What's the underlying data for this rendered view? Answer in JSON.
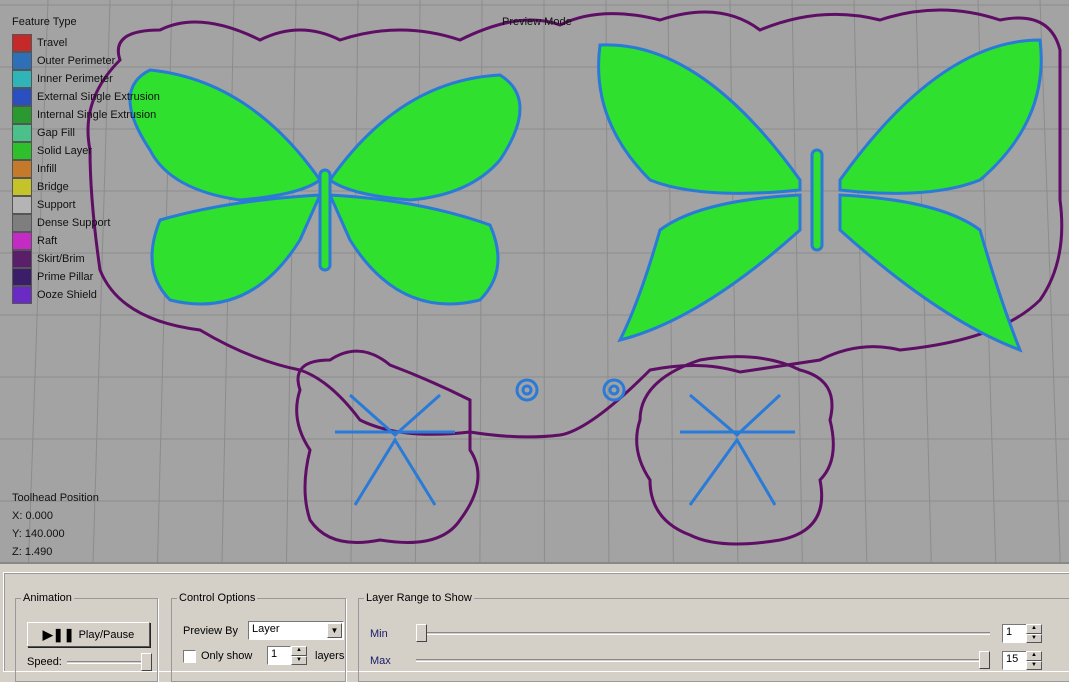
{
  "viewport": {
    "legend_title": "Feature Type",
    "legend": [
      {
        "label": "Travel",
        "color": "#c42a2a"
      },
      {
        "label": "Outer Perimeter",
        "color": "#2f6fb8"
      },
      {
        "label": "Inner Perimeter",
        "color": "#2fb5b8"
      },
      {
        "label": "External Single Extrusion",
        "color": "#2a4fc0"
      },
      {
        "label": "Internal Single Extrusion",
        "color": "#2a9a30"
      },
      {
        "label": "Gap Fill",
        "color": "#4cc08a"
      },
      {
        "label": "Solid Layer",
        "color": "#2ec02a"
      },
      {
        "label": "Infill",
        "color": "#c47a2a"
      },
      {
        "label": "Bridge",
        "color": "#c4c42a"
      },
      {
        "label": "Support",
        "color": "#b4b4b4"
      },
      {
        "label": "Dense Support",
        "color": "#7e7e7e"
      },
      {
        "label": "Raft",
        "color": "#c42ac4"
      },
      {
        "label": "Skirt/Brim",
        "color": "#5a1e6a"
      },
      {
        "label": "Prime Pillar",
        "color": "#3a1e6a"
      },
      {
        "label": "Ooze Shield",
        "color": "#6a2ac4"
      }
    ],
    "mode": "Preview Mode",
    "toolhead": {
      "title": "Toolhead Position",
      "x": "X: 0.000",
      "y": "Y: 140.000",
      "z": "Z: 1.490"
    }
  },
  "animation": {
    "title": "Animation",
    "play_label": "Play/Pause",
    "speed_label": "Speed:",
    "speed_value": 1.0
  },
  "control": {
    "title": "Control Options",
    "preview_by_label": "Preview By",
    "preview_by_value": "Layer",
    "only_show_label": "Only show",
    "only_show_checked": false,
    "only_show_value": "1",
    "layers_label": "layers"
  },
  "range": {
    "title": "Layer Range to Show",
    "min_label": "Min",
    "min_value": "1",
    "max_label": "Max",
    "max_value": "15",
    "total_layers": 15
  }
}
